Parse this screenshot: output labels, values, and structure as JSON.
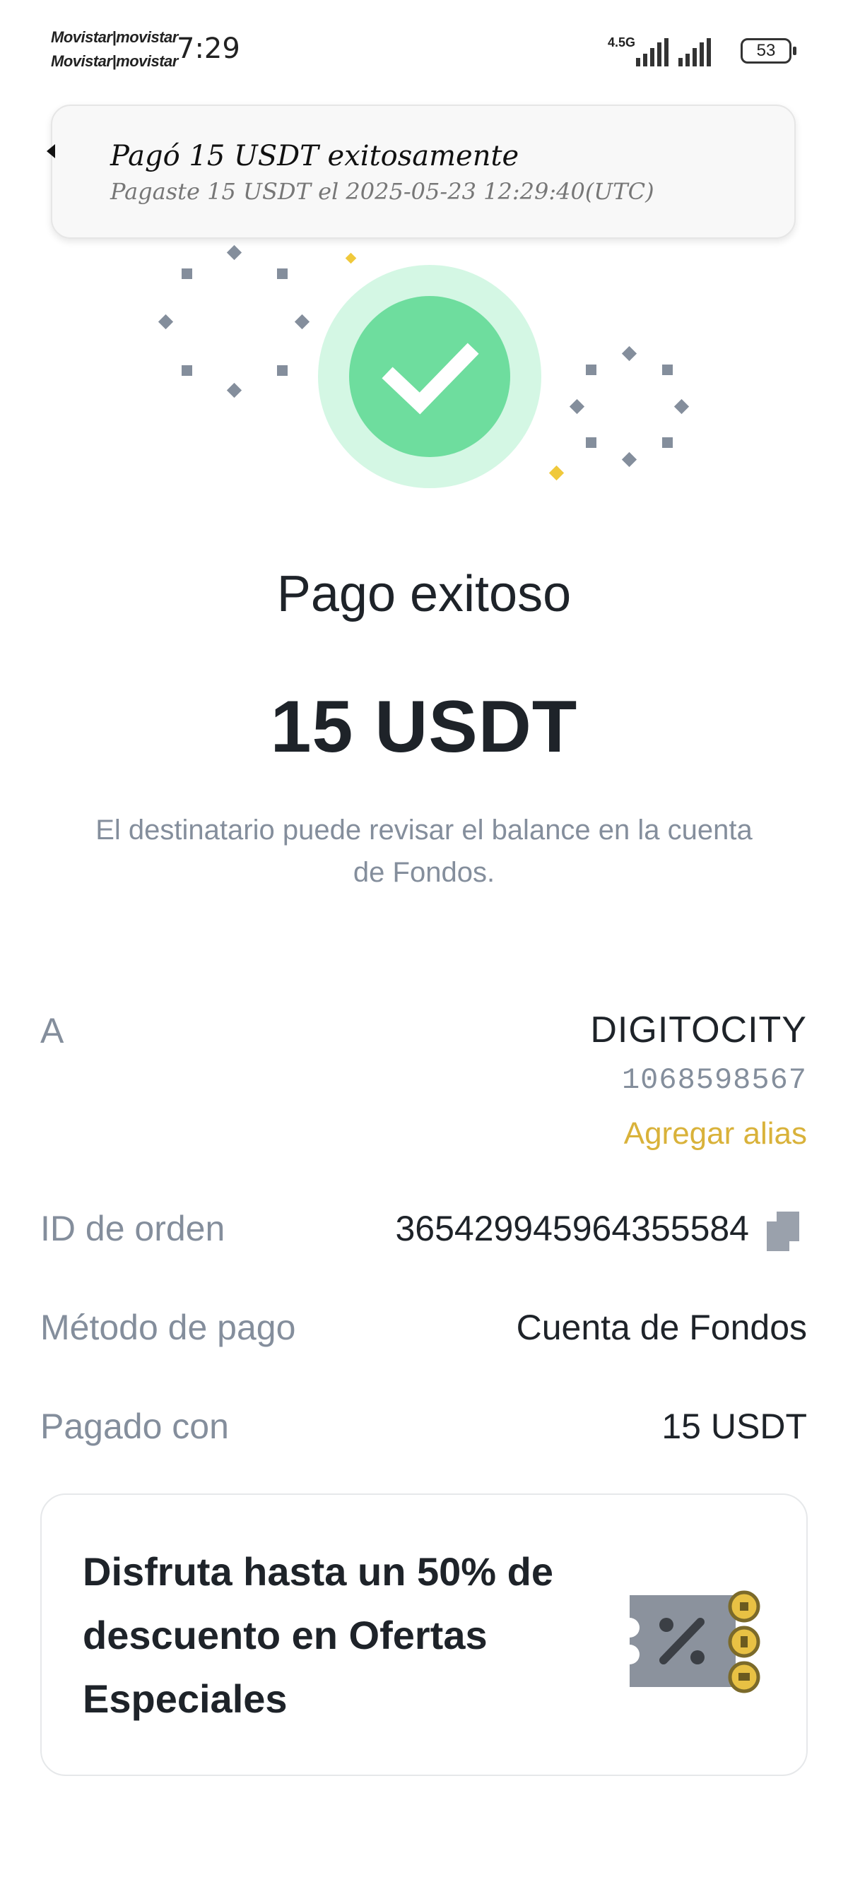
{
  "status_bar": {
    "carrier_1": "Movistar|movistar",
    "carrier_2": "Movistar|movistar",
    "time": "7:29",
    "network": "4.5G",
    "battery": "53"
  },
  "toast": {
    "title": "Pagó 15 USDT exitosamente",
    "subtitle": "Pagaste 15 USDT el 2025-05-23 12:29:40(UTC)"
  },
  "result": {
    "icon": "check-icon",
    "title": "Pago exitoso",
    "amount": "15 USDT",
    "note": "El destinatario puede revisar el balance en la cuenta de Fondos."
  },
  "details": {
    "to_label": "A",
    "to_name": "DIGITOCITY",
    "to_id": "1068598567",
    "add_alias": "Agregar alias",
    "order_label": "ID de orden",
    "order_value": "365429945964355584",
    "method_label": "Método de pago",
    "method_value": "Cuenta de Fondos",
    "paid_label": "Pagado con",
    "paid_value": "15 USDT"
  },
  "promo": {
    "text": "Disfruta hasta un 50% de descuento en Ofertas Especiales",
    "icon": "discount-coupon-icon"
  },
  "colors": {
    "success": "#6edd9e",
    "success_ring": "#d4f7e4",
    "accent": "#d9b23a",
    "muted": "#848e9c",
    "text": "#1e2329"
  }
}
